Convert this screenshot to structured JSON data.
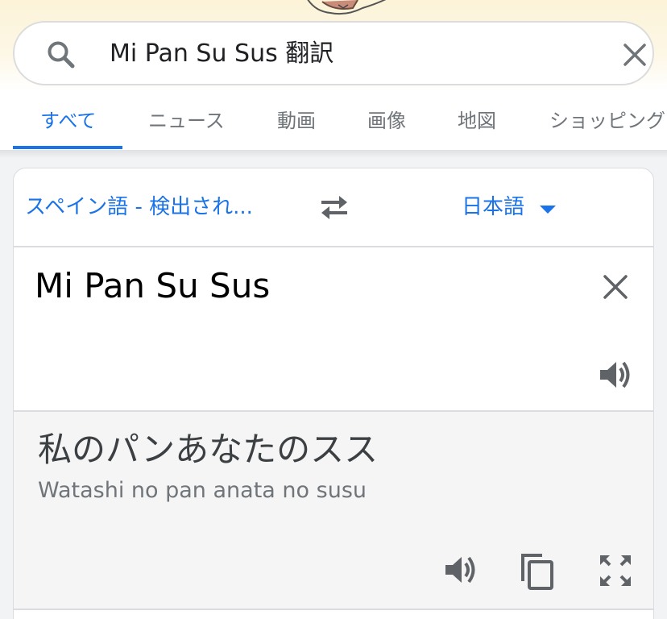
{
  "search": {
    "query": "Mi Pan Su Sus 翻訳"
  },
  "tabs": [
    {
      "label": "すべて",
      "active": true
    },
    {
      "label": "ニュース"
    },
    {
      "label": "動画"
    },
    {
      "label": "画像"
    },
    {
      "label": "地図"
    },
    {
      "label": "ショッピング"
    }
  ],
  "translate": {
    "source_language": "スペイン語 - 検出され...",
    "target_language": "日本語",
    "source_text": "Mi Pan Su Sus",
    "translated_text": "私のパンあなたのスス",
    "romanization": "Watashi no pan anata no susu"
  },
  "colors": {
    "accent": "#1a73e8",
    "icon_gray": "#70757a"
  },
  "icons": {
    "search": "search-icon",
    "clear": "close-icon",
    "swap": "swap-icon",
    "dropdown": "caret-down-icon",
    "speaker": "speaker-icon",
    "copy": "copy-icon",
    "expand": "fullscreen-icon"
  }
}
